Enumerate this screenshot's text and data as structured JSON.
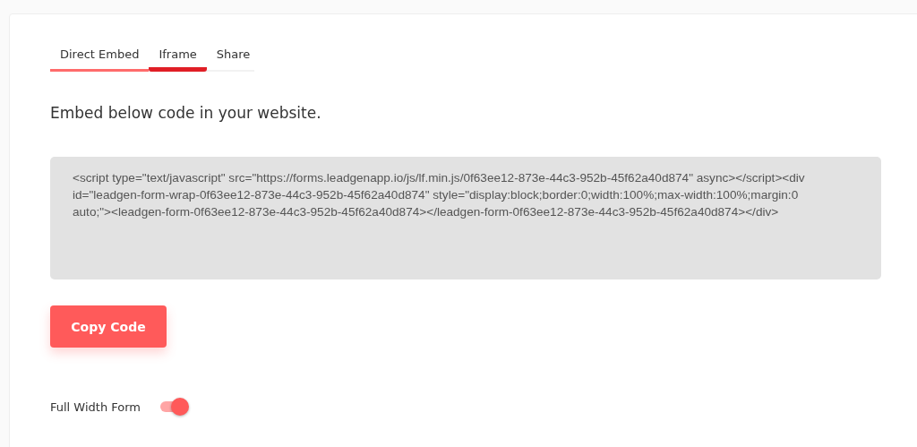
{
  "tabs": [
    {
      "label": "Direct Embed",
      "selected": true,
      "hovered": false
    },
    {
      "label": "Iframe",
      "selected": false,
      "hovered": true
    },
    {
      "label": "Share",
      "selected": false,
      "hovered": false
    }
  ],
  "heading": "Embed below code in your website.",
  "code": "<script type=\"text/javascript\" src=\"https://forms.leadgenapp.io/js/lf.min.js/0f63ee12-873e-44c3-952b-45f62a40d874\" async></script><div id=\"leadgen-form-wrap-0f63ee12-873e-44c3-952b-45f62a40d874\" style=\"display:block;border:0;width:100%;max-width:100%;margin:0 auto;\"><leadgen-form-0f63ee12-873e-44c3-952b-45f62a40d874></leadgen-form-0f63ee12-873e-44c3-952b-45f62a40d874></div>",
  "copy_button": "Copy Code",
  "full_width": {
    "label": "Full Width Form",
    "on": true
  }
}
